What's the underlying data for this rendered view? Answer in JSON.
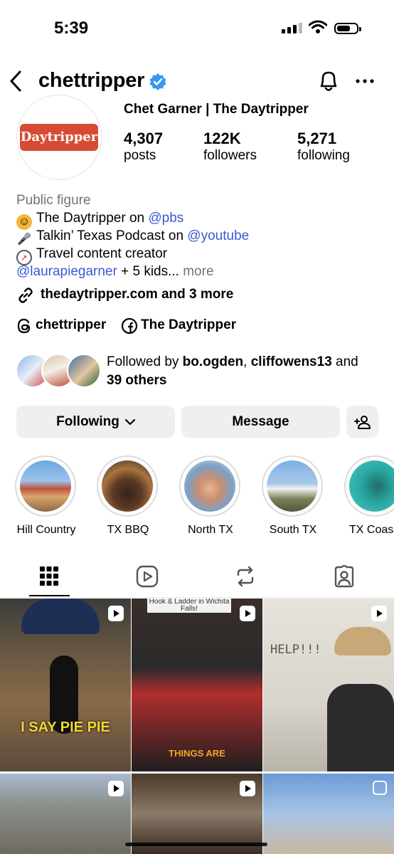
{
  "status": {
    "time": "5:39"
  },
  "header": {
    "username": "chettripper"
  },
  "profile": {
    "avatar_text": "Daytripper",
    "full_name": "Chet Garner | The Daytripper",
    "stats": [
      {
        "value": "4,307",
        "label": "posts"
      },
      {
        "value": "122K",
        "label": "followers"
      },
      {
        "value": "5,271",
        "label": "following"
      }
    ]
  },
  "bio": {
    "category": "Public figure",
    "line1_text": "The Daytripper on ",
    "line1_link": "@pbs",
    "line2_text": "Talkin’ Texas Podcast on ",
    "line2_link": "@youtube",
    "line3_text": "Travel content creator",
    "line4_link": "@laurapiegarner",
    "line4_text": " + 5 kids...",
    "more": "more",
    "website": "thedaytripper.com and 3 more",
    "threads": "chettripper",
    "facebook": "The Daytripper"
  },
  "followed_by": {
    "prefix": "Followed by ",
    "user1": "bo.ogden",
    "sep": ", ",
    "user2": "cliffowens13",
    "and": " and",
    "others": "39 others"
  },
  "actions": {
    "following": "Following",
    "message": "Message"
  },
  "highlights": [
    {
      "label": "Hill Country"
    },
    {
      "label": "TX BBQ"
    },
    {
      "label": "North TX"
    },
    {
      "label": "South TX"
    },
    {
      "label": "TX Coas"
    }
  ],
  "grid": {
    "post2_top": "Hook & Ladder in Wichita Falls!",
    "post1_caption": "I SAY PIE PIE",
    "post2_caption": "THINGS ARE",
    "post3_caption": "HELP!!!"
  },
  "colors": {
    "link": "#385ad6",
    "button_bg": "#efefef",
    "verified": "#3897f0",
    "logo": "#d64b34"
  }
}
